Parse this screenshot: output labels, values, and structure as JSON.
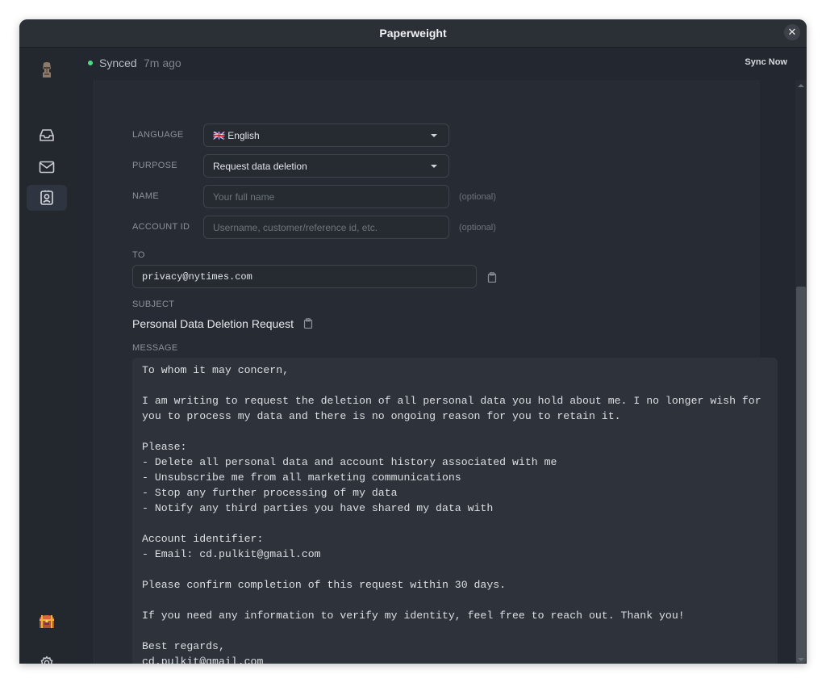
{
  "window": {
    "title": "Paperweight"
  },
  "sync": {
    "status": "Synced",
    "time": "7m ago",
    "button": "Sync Now"
  },
  "sidebar": {
    "items": [
      {
        "icon": "moai-logo-icon"
      },
      {
        "icon": "inbox-icon"
      },
      {
        "icon": "mail-icon"
      },
      {
        "icon": "contact-card-icon",
        "active": true
      },
      {
        "icon": "treasure-chest-icon"
      },
      {
        "icon": "gear-icon"
      }
    ]
  },
  "form": {
    "language": {
      "label": "LANGUAGE",
      "value": "🇬🇧 English"
    },
    "purpose": {
      "label": "PURPOSE",
      "value": "Request data deletion"
    },
    "name": {
      "label": "NAME",
      "placeholder": "Your full name",
      "hint": "(optional)"
    },
    "account_id": {
      "label": "ACCOUNT ID",
      "placeholder": "Username, customer/reference id, etc.",
      "hint": "(optional)"
    },
    "to": {
      "label": "TO",
      "value": "privacy@nytimes.com"
    },
    "subject": {
      "label": "SUBJECT",
      "value": "Personal Data Deletion Request"
    },
    "message": {
      "label": "MESSAGE",
      "lines": [
        "To whom it may concern,",
        "",
        "I am writing to request the deletion of all personal data you hold about me. I no longer wish for",
        "you to process my data and there is no ongoing reason for you to retain it.",
        "",
        "Please:",
        "- Delete all personal data and account history associated with me",
        "- Unsubscribe me from all marketing communications",
        "- Stop any further processing of my data",
        "- Notify any third parties you have shared my data with",
        "",
        "Account identifier:",
        "- Email: cd.pulkit@gmail.com",
        "",
        "Please confirm completion of this request within 30 days.",
        "",
        "If you need any information to verify my identity, feel free to reach out. Thank you!",
        "",
        "Best regards,",
        "cd.pulkit@gmail.com"
      ]
    }
  },
  "colors": {
    "synced_dot": "#4ade80",
    "background": "#232830"
  }
}
